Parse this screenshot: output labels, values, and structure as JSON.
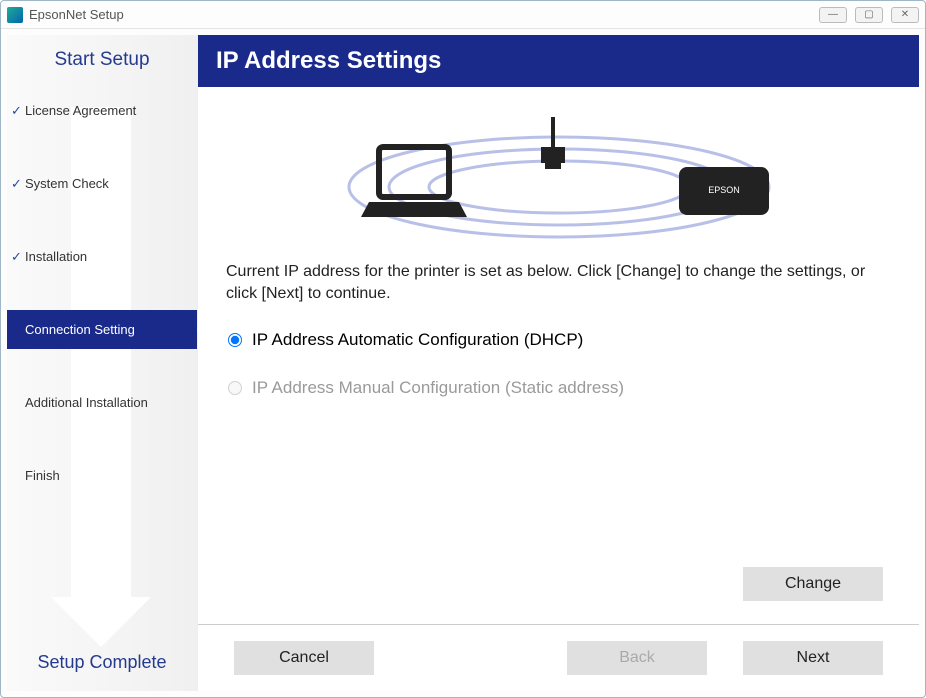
{
  "window": {
    "title": "EpsonNet Setup"
  },
  "sidebar": {
    "start": "Start Setup",
    "complete": "Setup Complete",
    "steps": {
      "license": "License Agreement",
      "system": "System Check",
      "install": "Installation",
      "connection": "Connection Setting",
      "additional": "Additional Installation",
      "finish": "Finish"
    }
  },
  "header": {
    "title": "IP Address Settings"
  },
  "illustration": {
    "printer_label": "EPSON"
  },
  "body": {
    "description": "Current IP address for the printer is set as below. Click [Change] to change the settings, or click [Next] to continue.",
    "option_dhcp": "IP Address Automatic Configuration (DHCP)",
    "option_static": "IP Address Manual Configuration (Static address)"
  },
  "buttons": {
    "change": "Change",
    "cancel": "Cancel",
    "back": "Back",
    "next": "Next"
  }
}
